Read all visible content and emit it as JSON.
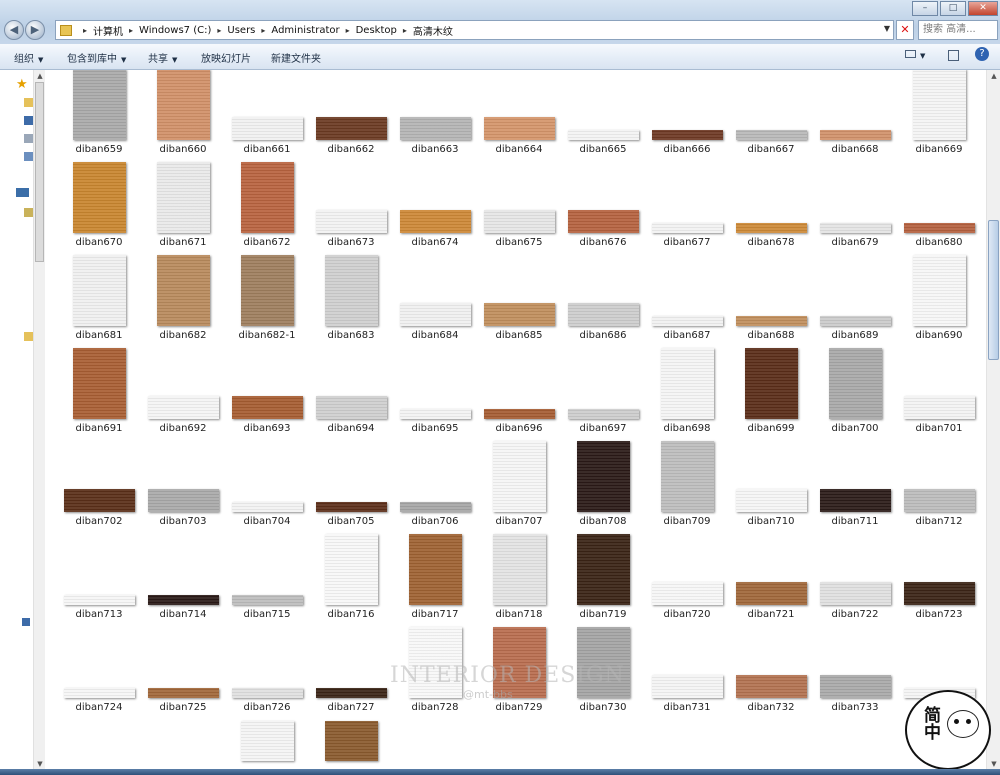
{
  "window": {
    "minimize": "–",
    "maximize": "□",
    "close": "✕"
  },
  "address": {
    "crumbs": [
      "计算机",
      "Windows7 (C:)",
      "Users",
      "Administrator",
      "Desktop",
      "高清木纹"
    ],
    "separator": "▸"
  },
  "search": {
    "placeholder": "搜索 高清..."
  },
  "toolbar": {
    "organize": "组织",
    "include_library": "包含到库中",
    "share": "共享",
    "slideshow": "放映幻灯片",
    "new_folder": "新建文件夹"
  },
  "nav": {
    "back": "◀",
    "forward": "▶"
  },
  "items": [
    {
      "name": "diban659",
      "color": "#a9a9a9",
      "o": "p"
    },
    {
      "name": "diban660",
      "color": "#d19068",
      "o": "p"
    },
    {
      "name": "diban661",
      "color": "#f1f1f1",
      "o": "l"
    },
    {
      "name": "diban662",
      "color": "#6b3a22",
      "o": "l"
    },
    {
      "name": "diban663",
      "color": "#b4b4b4",
      "o": "l"
    },
    {
      "name": "diban664",
      "color": "#d4956a",
      "o": "l"
    },
    {
      "name": "diban665",
      "color": "#f3f3f3",
      "o": "s"
    },
    {
      "name": "diban666",
      "color": "#6e3924",
      "o": "s"
    },
    {
      "name": "diban667",
      "color": "#b8b8b8",
      "o": "s"
    },
    {
      "name": "diban668",
      "color": "#d0916a",
      "o": "s"
    },
    {
      "name": "diban669",
      "color": "#f4f4f4",
      "o": "p"
    },
    {
      "name": "diban670",
      "color": "#c9862f",
      "o": "p"
    },
    {
      "name": "diban671",
      "color": "#e9e9e9",
      "o": "p"
    },
    {
      "name": "diban672",
      "color": "#b8633f",
      "o": "p"
    },
    {
      "name": "diban673",
      "color": "#f2f2f2",
      "o": "l"
    },
    {
      "name": "diban674",
      "color": "#cd8836",
      "o": "l"
    },
    {
      "name": "diban675",
      "color": "#e6e6e6",
      "o": "l"
    },
    {
      "name": "diban676",
      "color": "#b5623f",
      "o": "l"
    },
    {
      "name": "diban677",
      "color": "#f2f2f2",
      "o": "s"
    },
    {
      "name": "diban678",
      "color": "#cd8a38",
      "o": "s"
    },
    {
      "name": "diban679",
      "color": "#e4e4e4",
      "o": "s"
    },
    {
      "name": "diban680",
      "color": "#b4613f",
      "o": "s"
    },
    {
      "name": "diban681",
      "color": "#f0f0f0",
      "o": "p"
    },
    {
      "name": "diban682",
      "color": "#b88a5c",
      "o": "p"
    },
    {
      "name": "diban682-1",
      "color": "#9e7e5e",
      "o": "p"
    },
    {
      "name": "diban683",
      "color": "#cfcfcf",
      "o": "p"
    },
    {
      "name": "diban684",
      "color": "#f0f0f0",
      "o": "l"
    },
    {
      "name": "diban685",
      "color": "#c08e5c",
      "o": "l"
    },
    {
      "name": "diban686",
      "color": "#cdcdcd",
      "o": "l"
    },
    {
      "name": "diban687",
      "color": "#f1f1f1",
      "o": "s"
    },
    {
      "name": "diban688",
      "color": "#c08e5c",
      "o": "s"
    },
    {
      "name": "diban689",
      "color": "#cbcbcb",
      "o": "s"
    },
    {
      "name": "diban690",
      "color": "#f6f6f6",
      "o": "p"
    },
    {
      "name": "diban691",
      "color": "#a85e33",
      "o": "p"
    },
    {
      "name": "diban692",
      "color": "#f4f4f4",
      "o": "l"
    },
    {
      "name": "diban693",
      "color": "#a65c31",
      "o": "l"
    },
    {
      "name": "diban694",
      "color": "#cfcfcf",
      "o": "l"
    },
    {
      "name": "diban695",
      "color": "#f3f3f3",
      "o": "s"
    },
    {
      "name": "diban696",
      "color": "#a55c33",
      "o": "s"
    },
    {
      "name": "diban697",
      "color": "#cdcdcd",
      "o": "s"
    },
    {
      "name": "diban698",
      "color": "#f4f4f4",
      "o": "p"
    },
    {
      "name": "diban699",
      "color": "#5a2d18",
      "o": "p"
    },
    {
      "name": "diban700",
      "color": "#a8a8a8",
      "o": "p"
    },
    {
      "name": "diban701",
      "color": "#f3f3f3",
      "o": "l"
    },
    {
      "name": "diban702",
      "color": "#5a2f18",
      "o": "l"
    },
    {
      "name": "diban703",
      "color": "#a9a9a9",
      "o": "l"
    },
    {
      "name": "diban704",
      "color": "#f2f2f2",
      "o": "s"
    },
    {
      "name": "diban705",
      "color": "#5c2f1a",
      "o": "s"
    },
    {
      "name": "diban706",
      "color": "#a6a6a6",
      "o": "s"
    },
    {
      "name": "diban707",
      "color": "#f5f5f5",
      "o": "p"
    },
    {
      "name": "diban708",
      "color": "#2a1a17",
      "o": "p"
    },
    {
      "name": "diban709",
      "color": "#bdbdbd",
      "o": "p"
    },
    {
      "name": "diban710",
      "color": "#f5f5f5",
      "o": "l"
    },
    {
      "name": "diban711",
      "color": "#2b1b18",
      "o": "l"
    },
    {
      "name": "diban712",
      "color": "#bcbcbc",
      "o": "l"
    },
    {
      "name": "diban713",
      "color": "#f5f5f5",
      "o": "s"
    },
    {
      "name": "diban714",
      "color": "#2a1a17",
      "o": "s"
    },
    {
      "name": "diban715",
      "color": "#bdbdbd",
      "o": "s"
    },
    {
      "name": "diban716",
      "color": "#f7f7f7",
      "o": "p"
    },
    {
      "name": "diban717",
      "color": "#9e6232",
      "o": "p"
    },
    {
      "name": "diban718",
      "color": "#e3e3e3",
      "o": "p"
    },
    {
      "name": "diban719",
      "color": "#3a2315",
      "o": "p"
    },
    {
      "name": "diban720",
      "color": "#f6f6f6",
      "o": "l"
    },
    {
      "name": "diban721",
      "color": "#a0673a",
      "o": "l"
    },
    {
      "name": "diban722",
      "color": "#e0e0e0",
      "o": "l"
    },
    {
      "name": "diban723",
      "color": "#3b2416",
      "o": "l"
    },
    {
      "name": "diban724",
      "color": "#f5f5f5",
      "o": "s"
    },
    {
      "name": "diban725",
      "color": "#a1673a",
      "o": "s"
    },
    {
      "name": "diban726",
      "color": "#e0e0e0",
      "o": "s"
    },
    {
      "name": "diban727",
      "color": "#3a2416",
      "o": "s"
    },
    {
      "name": "diban728",
      "color": "#f8f8f8",
      "o": "p"
    },
    {
      "name": "diban729",
      "color": "#b86c4e",
      "o": "p"
    },
    {
      "name": "diban730",
      "color": "#a4a4a4",
      "o": "p"
    },
    {
      "name": "diban731",
      "color": "#f4f4f4",
      "o": "l"
    },
    {
      "name": "diban732",
      "color": "#b27250",
      "o": "l"
    },
    {
      "name": "diban733",
      "color": "#a9a9a9",
      "o": "l"
    },
    {
      "name": "",
      "color": "#f4f4f4",
      "o": "s"
    },
    {
      "name": "",
      "color": "#f4f4f4",
      "o": "h",
      "col": 2
    },
    {
      "name": "",
      "color": "#8a5a2e",
      "o": "h",
      "col": 3
    }
  ],
  "watermark": {
    "title": "INTERIOR DESIGN",
    "sub": "@mt-bbs"
  },
  "stamp": {
    "chars": "简中"
  }
}
